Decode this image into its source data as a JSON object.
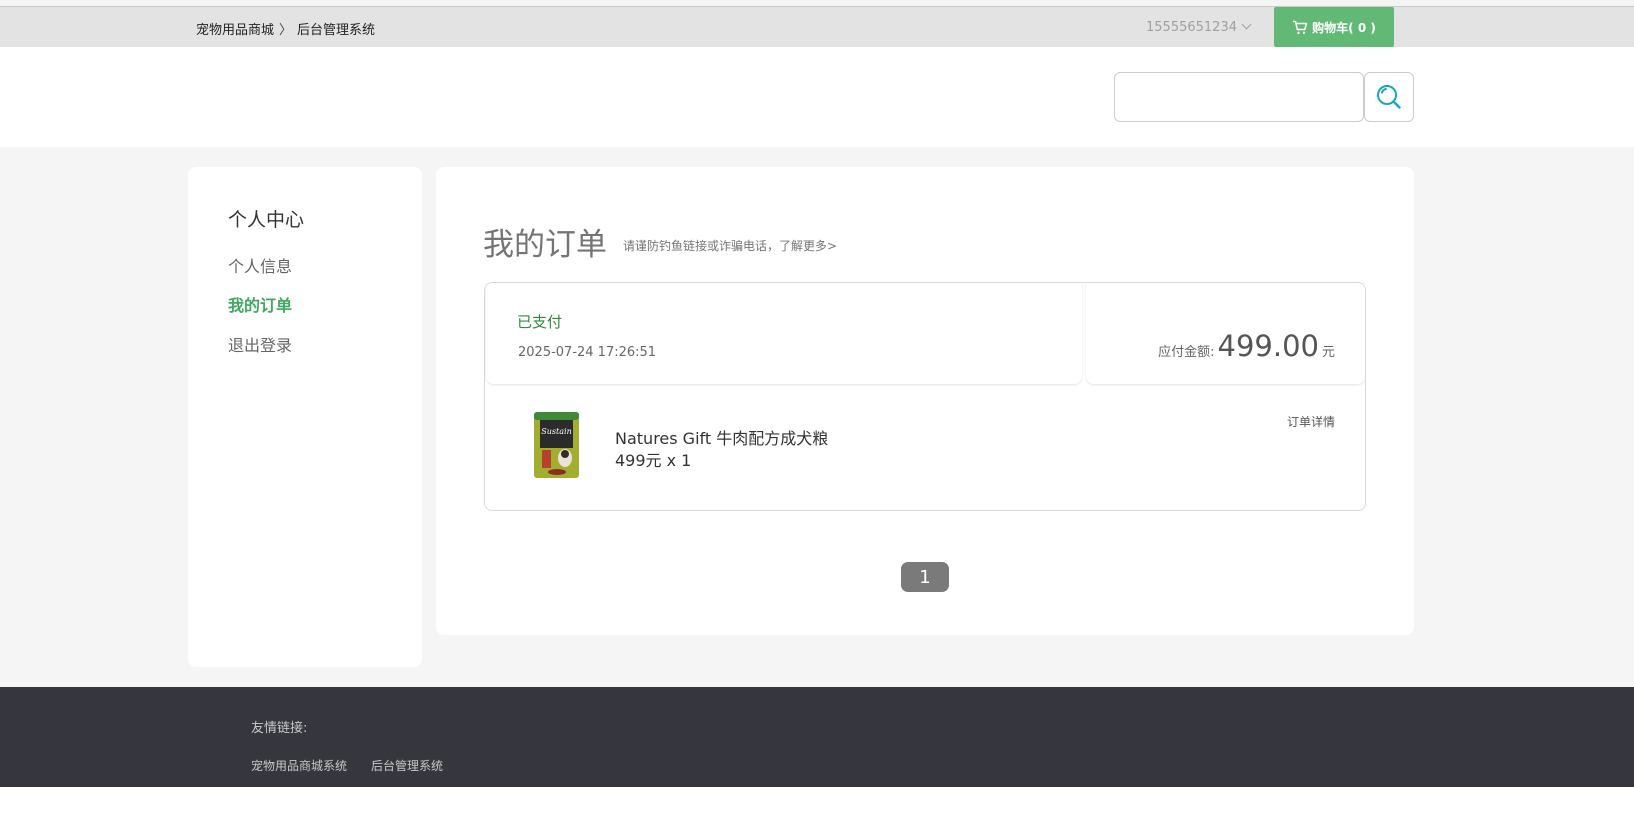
{
  "topbar": {
    "crumb_shop": "宠物用品商城",
    "crumb_separator": "〉",
    "crumb_admin": "后台管理系统",
    "phone": "15555651234",
    "cart_label": "购物车( 0 )"
  },
  "search": {
    "value": "",
    "placeholder": ""
  },
  "sidebar": {
    "title": "个人中心",
    "items": [
      {
        "label": "个人信息"
      },
      {
        "label": "我的订单"
      },
      {
        "label": "退出登录"
      }
    ]
  },
  "orders": {
    "title": "我的订单",
    "tip": "请谨防钓鱼链接或诈骗电话，了解更多>",
    "list": [
      {
        "status": "已支付",
        "time": "2025-07-24 17:26:51",
        "amount_label": "应付金额:",
        "amount": "499.00",
        "amount_unit": "元",
        "product_name": "Natures Gift 牛肉配方成犬粮",
        "product_price": "499元 x 1",
        "product_image_text": "Sustain",
        "detail_label": "订单详情"
      }
    ],
    "page": "1"
  },
  "footer": {
    "title": "友情链接:",
    "links": [
      {
        "label": "宠物用品商城系统"
      },
      {
        "label": "后台管理系统"
      }
    ]
  },
  "colors": {
    "accent": "#41a85f",
    "cart": "#62b976",
    "footer": "#35363e",
    "pager": "#7a7a7a"
  }
}
